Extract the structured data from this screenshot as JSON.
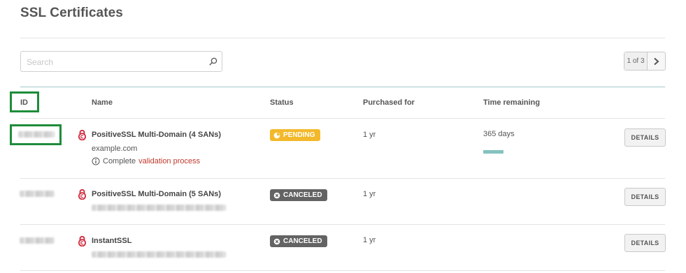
{
  "page_title": "SSL Certificates",
  "search": {
    "placeholder": "Search",
    "value": ""
  },
  "pagination": {
    "label": "1 of 3"
  },
  "table": {
    "columns": [
      "ID",
      "Name",
      "Status",
      "Purchased for",
      "Time remaining"
    ]
  },
  "rows": [
    {
      "name": "PositiveSSL Multi-Domain (4 SANs)",
      "domain": "example.com",
      "note_prefix": "Complete",
      "note_link": "validation process",
      "status": "PENDING",
      "purchased_for": "1 yr",
      "time_remaining": "365 days",
      "remaining_fraction": 1.0,
      "action": "DETAILS"
    },
    {
      "name": "PositiveSSL Multi-Domain (5 SANs)",
      "status": "CANCELED",
      "purchased_for": "1 yr",
      "action": "DETAILS"
    },
    {
      "name": "InstantSSL",
      "status": "CANCELED",
      "purchased_for": "1 yr",
      "action": "DETAILS"
    }
  ],
  "colors": {
    "pending": "#f3b92b",
    "canceled": "#636363",
    "highlight": "#1e8c3a",
    "lock": "#d0283c",
    "link": "#c0392b",
    "progress": "#84c2bf"
  }
}
